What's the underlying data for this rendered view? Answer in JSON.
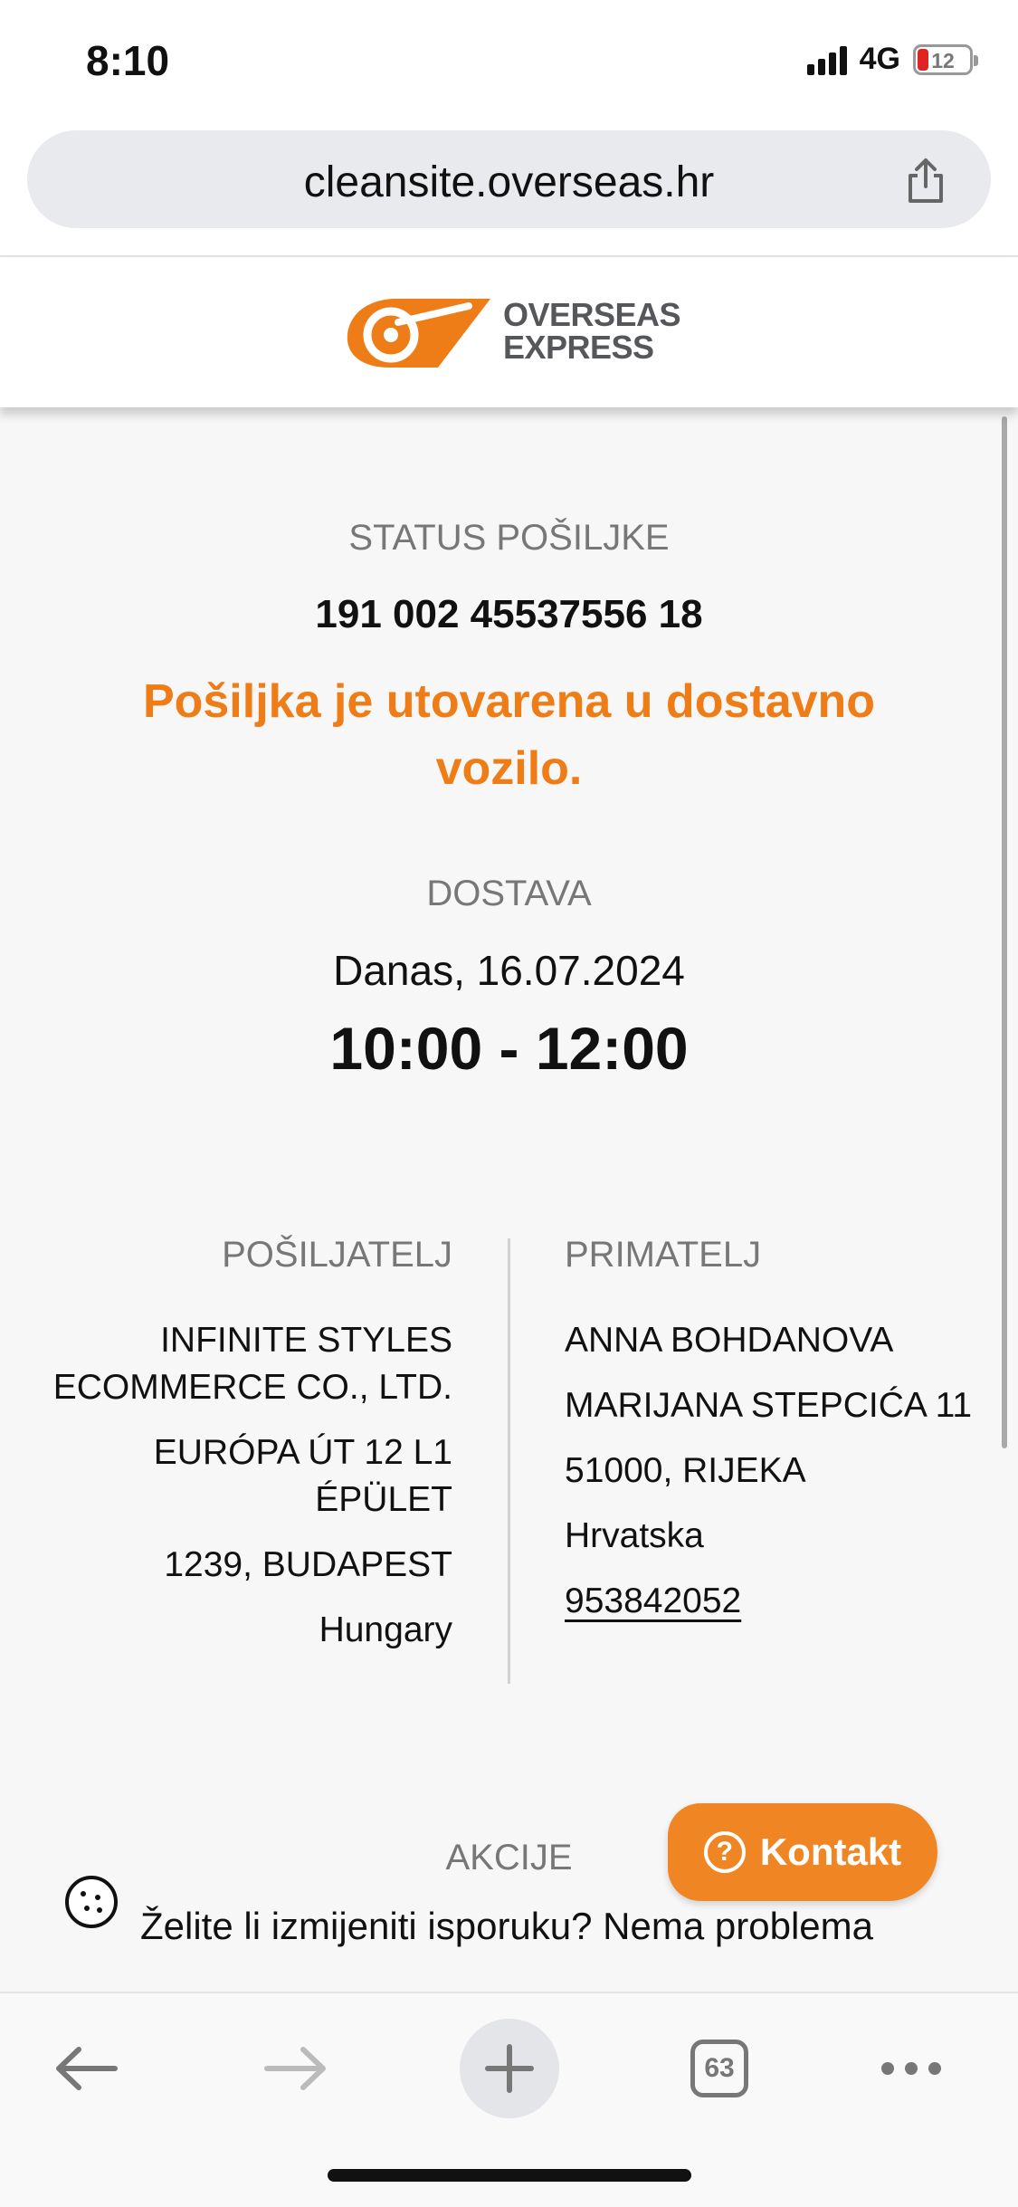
{
  "status_bar": {
    "time": "8:10",
    "network": "4G",
    "battery_level": "12"
  },
  "browser": {
    "url": "cleansite.overseas.hr",
    "tab_count": "63"
  },
  "site": {
    "logo_line1": "OVERSEAS",
    "logo_line2": "EXPRESS",
    "brand_color": "#ef7d17"
  },
  "shipment": {
    "status_label": "STATUS POŠILJKE",
    "tracking_number": "191 002 45537556 18",
    "status_message_line1": "Pošiljka je utovarena u dostavno",
    "status_message_line2": "vozilo.",
    "delivery_label": "DOSTAVA",
    "delivery_date": "Danas, 16.07.2024",
    "delivery_slot": "10:00 - 12:00"
  },
  "sender": {
    "heading": "POŠILJATELJ",
    "lines": [
      "INFINITE STYLES ECOMMERCE CO., LTD.",
      "EURÓPA ÚT 12 L1 ÉPÜLET",
      "1239, BUDAPEST",
      "Hungary"
    ]
  },
  "recipient": {
    "heading": "PRIMATELJ",
    "lines": [
      "ANNA BOHDANOVA",
      "MARIJANA STEPCIĆA 11",
      "51000, RIJEKA",
      "Hrvatska"
    ],
    "phone": "953842052"
  },
  "actions": {
    "heading": "AKCIJE",
    "change_text": "Želite li izmijeniti isporuku? Nema problema",
    "contact_button": "Kontakt"
  },
  "icons": {
    "share": "share-icon",
    "cookie": "cookie-icon",
    "back": "back-arrow-icon",
    "forward": "forward-arrow-icon",
    "new_tab": "plus-icon",
    "tabs": "tabs-icon",
    "more": "more-icon"
  }
}
